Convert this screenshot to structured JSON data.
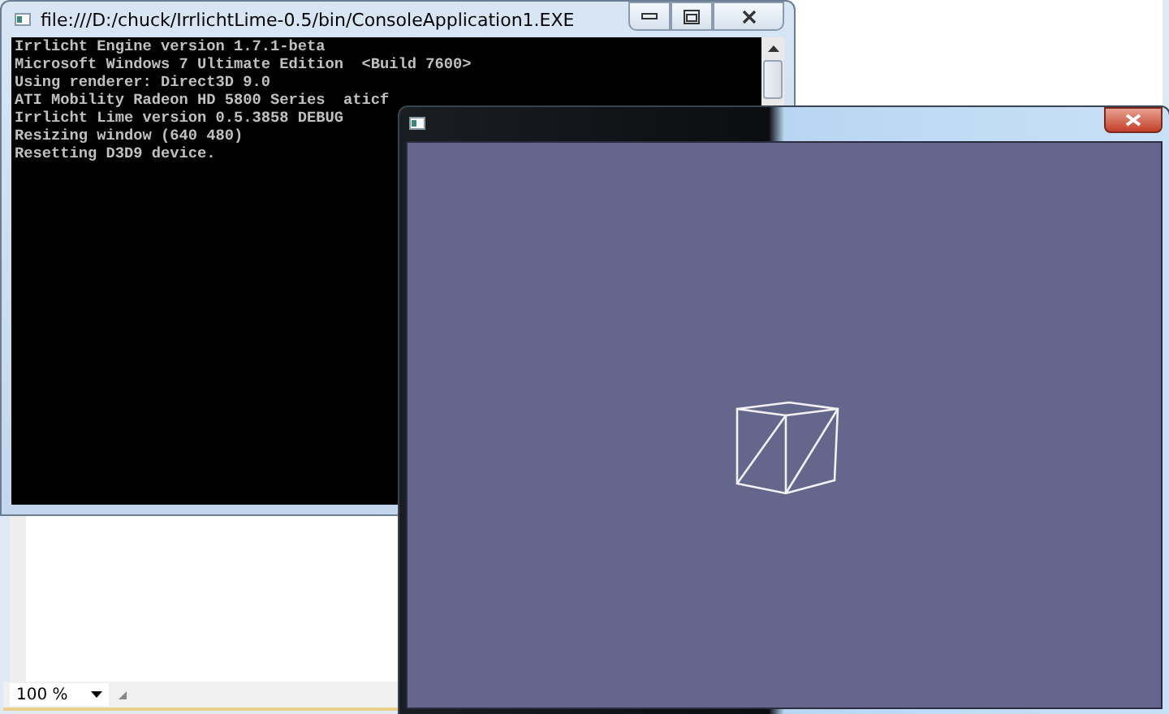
{
  "background_window": {
    "zoom": "100 %"
  },
  "console": {
    "title": "file:///D:/chuck/IrrlichtLime-0.5/bin/ConsoleApplication1.EXE",
    "lines": [
      "Irrlicht Engine version 1.7.1-beta",
      "Microsoft Windows 7 Ultimate Edition  <Build 7600>",
      "Using renderer: Direct3D 9.0",
      "ATI Mobility Radeon HD 5800 Series  aticf",
      "Irrlicht Lime version 0.5.3858 DEBUG",
      "Resizing window (640 480)",
      "Resetting D3D9 device."
    ]
  }
}
